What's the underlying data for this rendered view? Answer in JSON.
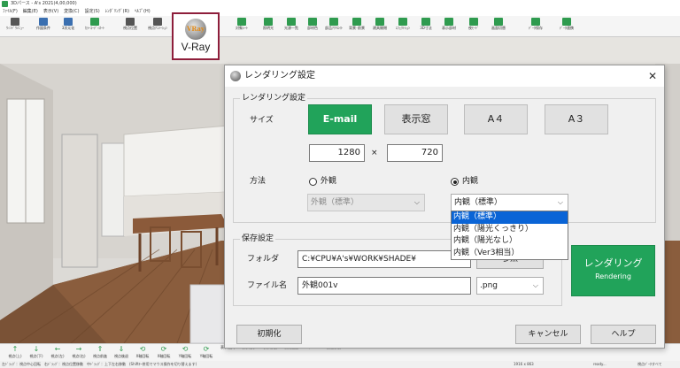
{
  "app": {
    "title": "3Dパース - A's 2021(4,00,000)",
    "menu": [
      "ﾌｧｲﾙ(F)",
      "編集(E)",
      "表示(V)",
      "変換(C)",
      "設定(S)",
      "ﾚﾝﾀﾞﾘﾝｸﾞ(R)",
      "ﾍﾙﾌﾟ(H)"
    ]
  },
  "toolbar": {
    "items": [
      {
        "label": "ｳｨﾝﾄﾞｳﾒﾆｭｰ",
        "color": "#555555"
      },
      {
        "label": "作図条件",
        "color": "#3a6fb0"
      },
      {
        "label": "3次元化",
        "color": "#3a6fb0"
      },
      {
        "label": "ｶﾗｰｺｰﾃﾞｨﾈｰﾄ",
        "color": "#2f9b4f"
      },
      {
        "label": "視点位置",
        "color": "#555555"
      },
      {
        "label": "視点ｱﾆﾒｰｼｮﾝ",
        "color": "#555555"
      },
      {
        "label": "対象ｼｰﾄ",
        "color": "#2f9b4f"
      },
      {
        "label": "照明光",
        "color": "#2f9b4f"
      },
      {
        "label": "光源一覧",
        "color": "#2f9b4f"
      },
      {
        "label": "部材色",
        "color": "#2f9b4f"
      },
      {
        "label": "部品ｱｸﾘｴｲﾄ",
        "color": "#2f9b4f"
      },
      {
        "label": "背景･前景",
        "color": "#2f9b4f"
      },
      {
        "label": "建具開閉",
        "color": "#2f9b4f"
      },
      {
        "label": "ｴﾌｪｸﾄｼｮﾝ",
        "color": "#2f9b4f"
      },
      {
        "label": "3D寸法",
        "color": "#2f9b4f"
      },
      {
        "label": "表示部材",
        "color": "#2f9b4f"
      },
      {
        "label": "夜ﾓｰﾄﾞ",
        "color": "#2f9b4f"
      },
      {
        "label": "画面切替",
        "color": "#2f9b4f"
      },
      {
        "label": "ﾃﾞｰﾀ保存",
        "color": "#2f9b4f"
      },
      {
        "label": "ﾃﾞｰﾀ連携",
        "color": "#2f9b4f"
      }
    ],
    "vray": {
      "logo_text": "VRay",
      "label": "V-Ray"
    }
  },
  "navbar": {
    "items": [
      {
        "arrow": "↑",
        "label": "視点(上)"
      },
      {
        "arrow": "↓",
        "label": "視点(下)"
      },
      {
        "arrow": "←",
        "label": "視点(左)"
      },
      {
        "arrow": "→",
        "label": "視点(右)"
      },
      {
        "arrow": "⇑",
        "label": "視点前進"
      },
      {
        "arrow": "⇓",
        "label": "視点後退"
      },
      {
        "arrow": "⟲",
        "label": "X軸回転"
      },
      {
        "arrow": "⟳",
        "label": "X軸回転"
      },
      {
        "arrow": "⟲",
        "label": "Y軸回転"
      },
      {
        "arrow": "⟳",
        "label": "Y軸回転"
      },
      {
        "arrow": "",
        "label": "表示拡大"
      },
      {
        "arrow": "",
        "label": "表示縮小"
      },
      {
        "arrow": "",
        "label": "表示移動"
      },
      {
        "arrow": "",
        "label": "初期画面"
      },
      {
        "arrow": "",
        "label": "ｸﾞﾙｰ"
      },
      {
        "arrow": "",
        "label": "数値移動"
      }
    ],
    "status_left": "左ﾄﾞﾗｯｸﾞ：視点中心回転　右ﾄﾞﾗｯｸﾞ：視点位置移動　中ﾄﾞﾗｯｸﾞ：上下左右移動　(Shiftｷｰ併用でマウス操作を切り替えます)",
    "size": "1916 x 863",
    "ready": "ready...",
    "right": "視点ﾃﾞｰﾀすべて"
  },
  "dialog": {
    "title": "レンダリング設定",
    "close": "✕",
    "render_settings_group": "レンダリング設定",
    "size_label": "サイズ",
    "size_buttons": [
      "E-mail",
      "表示窓",
      "A４",
      "A３"
    ],
    "width": "1280",
    "times": "×",
    "height": "720",
    "method_label": "方法",
    "exterior_label": "外観",
    "interior_label": "内観",
    "exterior_select": "外観（標準）",
    "interior_select": "内観（標準）",
    "interior_options": [
      "内観（標準）",
      "内観（陽光くっきり）",
      "内観（陽光なし）",
      "内観（Ver3相当）"
    ],
    "save_group": "保存設定",
    "folder_label": "フォルダ",
    "folder_value": "C:¥CPU¥A's¥WORK¥SHADE¥",
    "browse_label": "参照",
    "filename_label": "ファイル名",
    "filename_value": "外観001v",
    "ext_value": ".png",
    "render_button": {
      "line1": "レンダリング",
      "line2": "Rendering"
    },
    "init_button": "初期化",
    "cancel_button": "キャンセル",
    "help_button": "ヘルプ"
  },
  "colors": {
    "accent_green": "#21a35a",
    "vray_border": "#8e1e3b",
    "selection_blue": "#0a64d6"
  }
}
